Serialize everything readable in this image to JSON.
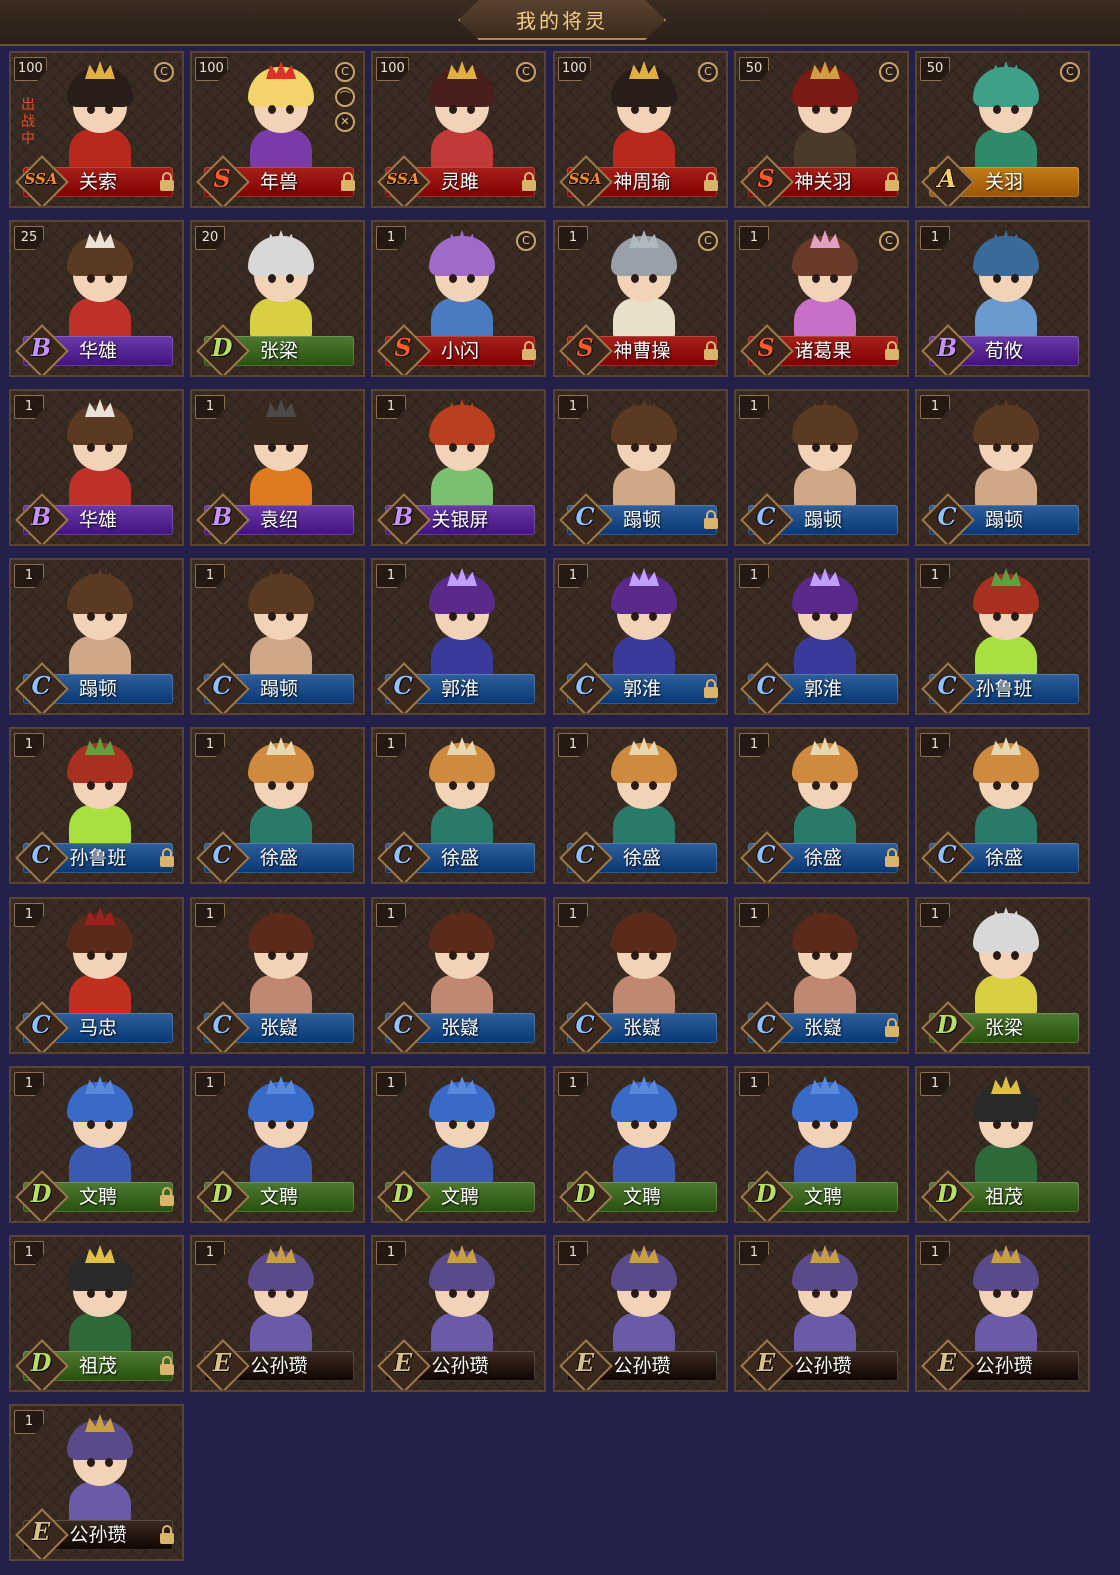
{
  "header": {
    "title": "我的将灵"
  },
  "labels": {
    "deploy": "出战中"
  },
  "grades": {
    "SSA": {
      "letter": "SSA",
      "bar": "#a8211a",
      "color": "#ff8a2a"
    },
    "S": {
      "letter": "S",
      "bar": "#a8211a",
      "color": "#ff5a2a"
    },
    "A": {
      "letter": "A",
      "bar": "#c47d18",
      "color": "#ffd060"
    },
    "B": {
      "letter": "B",
      "bar": "#6a3aa8",
      "color": "#c890ff"
    },
    "C": {
      "letter": "C",
      "bar": "#2f5f9c",
      "color": "#8fc0ff"
    },
    "D": {
      "letter": "D",
      "bar": "#4f7a34",
      "color": "#b8e060"
    },
    "E": {
      "letter": "E",
      "bar": "#3a2c22",
      "color": "#d8c08a"
    }
  },
  "cards": [
    {
      "level": "100",
      "name": "关索",
      "grade": "SSA",
      "locked": true,
      "deployed": true,
      "icons": [
        "c-icon"
      ],
      "look": "general-red"
    },
    {
      "level": "100",
      "name": "年兽",
      "grade": "S",
      "locked": true,
      "deployed": false,
      "icons": [
        "c-icon",
        "hat-icon",
        "sword-icon"
      ],
      "look": "beast"
    },
    {
      "level": "100",
      "name": "灵雎",
      "grade": "SSA",
      "locked": true,
      "deployed": false,
      "icons": [
        "c-icon"
      ],
      "look": "lady-red"
    },
    {
      "level": "100",
      "name": "神周瑜",
      "grade": "SSA",
      "locked": true,
      "deployed": false,
      "icons": [
        "c-icon"
      ],
      "look": "general-red"
    },
    {
      "level": "50",
      "name": "神关羽",
      "grade": "S",
      "locked": true,
      "deployed": false,
      "icons": [
        "c-icon"
      ],
      "look": "warrior-red"
    },
    {
      "level": "50",
      "name": "关羽",
      "grade": "A",
      "locked": false,
      "deployed": false,
      "icons": [
        "c-icon"
      ],
      "look": "green"
    },
    {
      "level": "25",
      "name": "华雄",
      "grade": "B",
      "locked": false,
      "deployed": false,
      "icons": [],
      "look": "bandana"
    },
    {
      "level": "20",
      "name": "张梁",
      "grade": "D",
      "locked": false,
      "deployed": false,
      "icons": [],
      "look": "white-hair"
    },
    {
      "level": "1",
      "name": "小闪",
      "grade": "S",
      "locked": true,
      "deployed": false,
      "icons": [
        "c-icon"
      ],
      "look": "lady-purple"
    },
    {
      "level": "1",
      "name": "神曹操",
      "grade": "S",
      "locked": true,
      "deployed": false,
      "icons": [
        "c-icon"
      ],
      "look": "silver"
    },
    {
      "level": "1",
      "name": "诸葛果",
      "grade": "S",
      "locked": true,
      "deployed": false,
      "icons": [
        "c-icon"
      ],
      "look": "lady-pink"
    },
    {
      "level": "1",
      "name": "荀攸",
      "grade": "B",
      "locked": false,
      "deployed": false,
      "icons": [],
      "look": "scholar-blue"
    },
    {
      "level": "1",
      "name": "华雄",
      "grade": "B",
      "locked": false,
      "deployed": false,
      "icons": [],
      "look": "bandana"
    },
    {
      "level": "1",
      "name": "袁绍",
      "grade": "B",
      "locked": false,
      "deployed": false,
      "icons": [],
      "look": "orange"
    },
    {
      "level": "1",
      "name": "关银屏",
      "grade": "B",
      "locked": false,
      "deployed": false,
      "icons": [],
      "look": "lady-green"
    },
    {
      "level": "1",
      "name": "蹋顿",
      "grade": "C",
      "locked": true,
      "deployed": false,
      "icons": [],
      "look": "barbarian"
    },
    {
      "level": "1",
      "name": "蹋顿",
      "grade": "C",
      "locked": false,
      "deployed": false,
      "icons": [],
      "look": "barbarian"
    },
    {
      "level": "1",
      "name": "蹋顿",
      "grade": "C",
      "locked": false,
      "deployed": false,
      "icons": [],
      "look": "barbarian"
    },
    {
      "level": "1",
      "name": "蹋顿",
      "grade": "C",
      "locked": false,
      "deployed": false,
      "icons": [],
      "look": "barbarian"
    },
    {
      "level": "1",
      "name": "蹋顿",
      "grade": "C",
      "locked": false,
      "deployed": false,
      "icons": [],
      "look": "barbarian"
    },
    {
      "level": "1",
      "name": "郭淮",
      "grade": "C",
      "locked": false,
      "deployed": false,
      "icons": [],
      "look": "purple"
    },
    {
      "level": "1",
      "name": "郭淮",
      "grade": "C",
      "locked": true,
      "deployed": false,
      "icons": [],
      "look": "purple"
    },
    {
      "level": "1",
      "name": "郭淮",
      "grade": "C",
      "locked": false,
      "deployed": false,
      "icons": [],
      "look": "purple"
    },
    {
      "level": "1",
      "name": "孙鲁班",
      "grade": "C",
      "locked": false,
      "deployed": false,
      "icons": [],
      "look": "lady-lime"
    },
    {
      "level": "1",
      "name": "孙鲁班",
      "grade": "C",
      "locked": true,
      "deployed": false,
      "icons": [],
      "look": "lady-lime"
    },
    {
      "level": "1",
      "name": "徐盛",
      "grade": "C",
      "locked": false,
      "deployed": false,
      "icons": [],
      "look": "teal"
    },
    {
      "level": "1",
      "name": "徐盛",
      "grade": "C",
      "locked": false,
      "deployed": false,
      "icons": [],
      "look": "teal"
    },
    {
      "level": "1",
      "name": "徐盛",
      "grade": "C",
      "locked": false,
      "deployed": false,
      "icons": [],
      "look": "teal"
    },
    {
      "level": "1",
      "name": "徐盛",
      "grade": "C",
      "locked": true,
      "deployed": false,
      "icons": [],
      "look": "teal"
    },
    {
      "level": "1",
      "name": "徐盛",
      "grade": "C",
      "locked": false,
      "deployed": false,
      "icons": [],
      "look": "teal"
    },
    {
      "level": "1",
      "name": "马忠",
      "grade": "C",
      "locked": false,
      "deployed": false,
      "icons": [],
      "look": "red-robe"
    },
    {
      "level": "1",
      "name": "张嶷",
      "grade": "C",
      "locked": false,
      "deployed": false,
      "icons": [],
      "look": "brown"
    },
    {
      "level": "1",
      "name": "张嶷",
      "grade": "C",
      "locked": false,
      "deployed": false,
      "icons": [],
      "look": "brown"
    },
    {
      "level": "1",
      "name": "张嶷",
      "grade": "C",
      "locked": false,
      "deployed": false,
      "icons": [],
      "look": "brown"
    },
    {
      "level": "1",
      "name": "张嶷",
      "grade": "C",
      "locked": true,
      "deployed": false,
      "icons": [],
      "look": "brown"
    },
    {
      "level": "1",
      "name": "张梁",
      "grade": "D",
      "locked": false,
      "deployed": false,
      "icons": [],
      "look": "white-hair"
    },
    {
      "level": "1",
      "name": "文聘",
      "grade": "D",
      "locked": true,
      "deployed": false,
      "icons": [],
      "look": "blue-armor"
    },
    {
      "level": "1",
      "name": "文聘",
      "grade": "D",
      "locked": false,
      "deployed": false,
      "icons": [],
      "look": "blue-armor"
    },
    {
      "level": "1",
      "name": "文聘",
      "grade": "D",
      "locked": false,
      "deployed": false,
      "icons": [],
      "look": "blue-armor"
    },
    {
      "level": "1",
      "name": "文聘",
      "grade": "D",
      "locked": false,
      "deployed": false,
      "icons": [],
      "look": "blue-armor"
    },
    {
      "level": "1",
      "name": "文聘",
      "grade": "D",
      "locked": false,
      "deployed": false,
      "icons": [],
      "look": "blue-armor"
    },
    {
      "level": "1",
      "name": "祖茂",
      "grade": "D",
      "locked": false,
      "deployed": false,
      "icons": [],
      "look": "dark-green"
    },
    {
      "level": "1",
      "name": "祖茂",
      "grade": "D",
      "locked": true,
      "deployed": false,
      "icons": [],
      "look": "dark-green"
    },
    {
      "level": "1",
      "name": "公孙瓒",
      "grade": "E",
      "locked": false,
      "deployed": false,
      "icons": [],
      "look": "horned"
    },
    {
      "level": "1",
      "name": "公孙瓒",
      "grade": "E",
      "locked": false,
      "deployed": false,
      "icons": [],
      "look": "horned"
    },
    {
      "level": "1",
      "name": "公孙瓒",
      "grade": "E",
      "locked": false,
      "deployed": false,
      "icons": [],
      "look": "horned"
    },
    {
      "level": "1",
      "name": "公孙瓒",
      "grade": "E",
      "locked": false,
      "deployed": false,
      "icons": [],
      "look": "horned"
    },
    {
      "level": "1",
      "name": "公孙瓒",
      "grade": "E",
      "locked": false,
      "deployed": false,
      "icons": [],
      "look": "horned"
    },
    {
      "level": "1",
      "name": "公孙瓒",
      "grade": "E",
      "locked": true,
      "deployed": false,
      "icons": [],
      "look": "horned"
    }
  ],
  "looks": {
    "general-red": {
      "hair": "#2a1c18",
      "body": "#b8281c",
      "crown": "#e0b040"
    },
    "beast": {
      "hair": "#f3d36a",
      "body": "#7a3aa8",
      "crown": "#e0302a"
    },
    "lady-red": {
      "hair": "#4a1e1a",
      "body": "#c03a3a",
      "crown": "#e0b040"
    },
    "warrior-red": {
      "hair": "#7a1a14",
      "body": "#4a3a2a",
      "crown": "#d0a040"
    },
    "green": {
      "hair": "#3fa08a",
      "body": "#2f8a6a",
      "crown": "#3fa08a"
    },
    "bandana": {
      "hair": "#5a3a22",
      "body": "#c0302a",
      "crown": "#e8e2d8"
    },
    "white-hair": {
      "hair": "#d8d8d8",
      "body": "#d8d040",
      "crown": "#d8d8d8"
    },
    "lady-purple": {
      "hair": "#a06ac8",
      "body": "#4a7ac0",
      "crown": "#a06ac8"
    },
    "silver": {
      "hair": "#9aa0aa",
      "body": "#e8e0c8",
      "crown": "#b0b8c0"
    },
    "lady-pink": {
      "hair": "#6a3a2a",
      "body": "#c870c8",
      "crown": "#e0a0c0"
    },
    "scholar-blue": {
      "hair": "#3a6a9a",
      "body": "#6a9ad0",
      "crown": "#3a6a9a"
    },
    "orange": {
      "hair": "#3a2a1e",
      "body": "#e07a20",
      "crown": "#4a4a4a"
    },
    "lady-green": {
      "hair": "#b8401e",
      "body": "#7ac070",
      "crown": "#b8401e"
    },
    "barbarian": {
      "hair": "#5a3a22",
      "body": "#d0a888",
      "crown": "#5a3a22"
    },
    "purple": {
      "hair": "#5a2a8a",
      "body": "#3a3a9a",
      "crown": "#c0a0ff"
    },
    "lady-lime": {
      "hair": "#a83020",
      "body": "#a8e040",
      "crown": "#60a040"
    },
    "teal": {
      "hair": "#d08a40",
      "body": "#2a7a6a",
      "crown": "#e8d8b0"
    },
    "red-robe": {
      "hair": "#5a2a1a",
      "body": "#c03020",
      "crown": "#a02020"
    },
    "brown": {
      "hair": "#5a2a1a",
      "body": "#c08870",
      "crown": "#5a2a1a"
    },
    "blue-armor": {
      "hair": "#3a6ac8",
      "body": "#3a5ab0",
      "crown": "#5a8ae0"
    },
    "dark-green": {
      "hair": "#2a2a2a",
      "body": "#2f6a3a",
      "crown": "#e0c040"
    },
    "horned": {
      "hair": "#5a4a8a",
      "body": "#6a5aa8",
      "crown": "#c8a040"
    }
  }
}
